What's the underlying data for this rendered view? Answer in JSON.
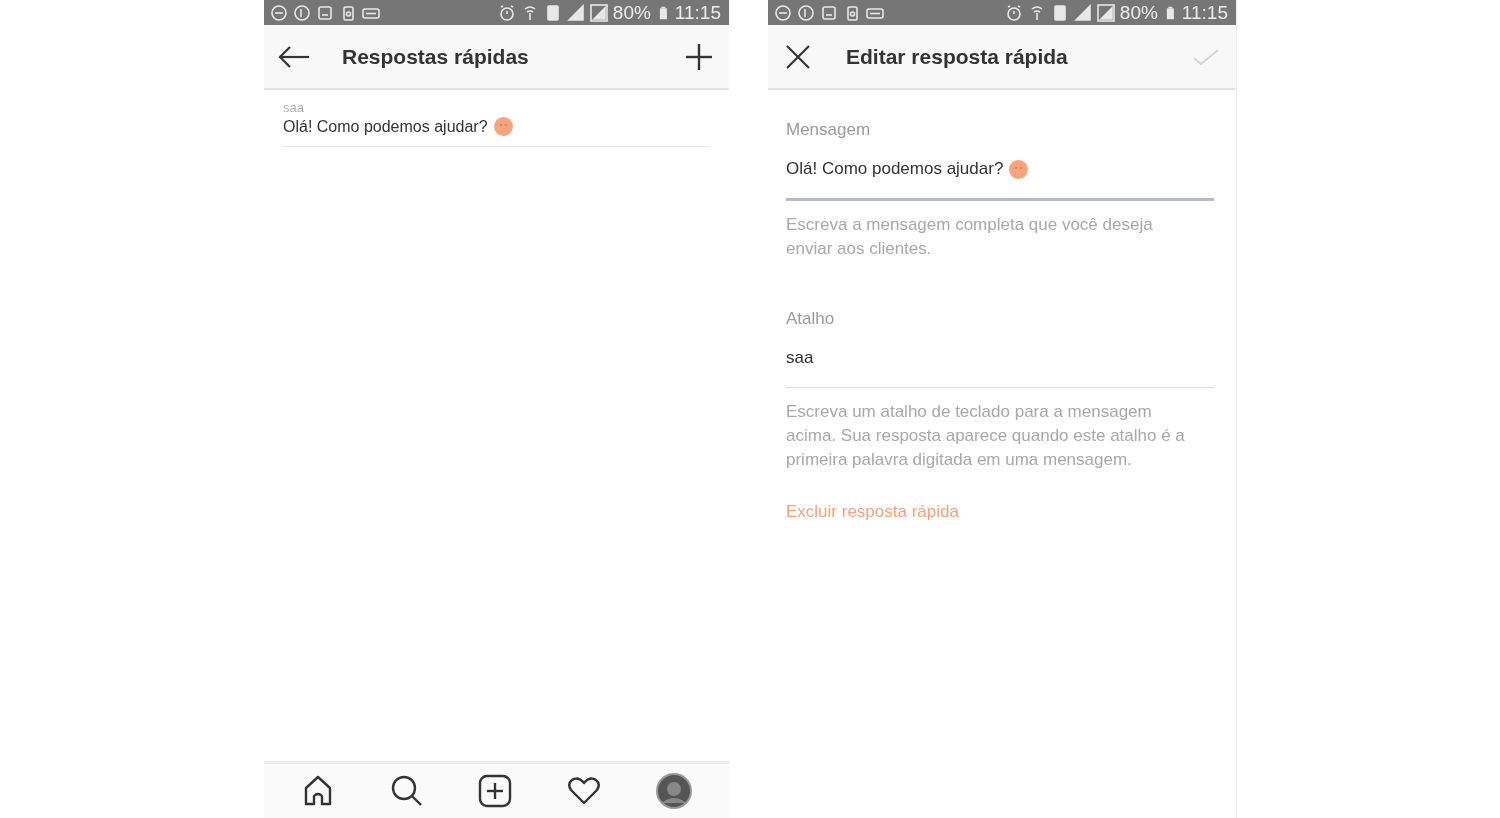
{
  "screens": [
    {
      "kind": "list",
      "status_bar": {
        "battery": "80%",
        "time": "11:15"
      },
      "header": {
        "title": "Respostas rápidas"
      },
      "items": [
        {
          "shortcut": "saa",
          "message": "Olá! Como podemos ajudar?"
        }
      ],
      "bottom_nav": [
        {
          "kind": "home"
        },
        {
          "kind": "search"
        },
        {
          "kind": "add"
        },
        {
          "kind": "heart"
        },
        {
          "kind": "avatar"
        }
      ]
    },
    {
      "kind": "edit",
      "status_bar": {
        "battery": "80%",
        "time": "11:15"
      },
      "header": {
        "title": "Editar resposta rápida",
        "save_disabled": true
      },
      "fields": [
        {
          "label": "Mensagem",
          "value": "Olá! Como podemos ajudar?",
          "emoji": true,
          "focused": true,
          "help": "Escreva a mensagem completa que você deseja enviar aos clientes."
        },
        {
          "label": "Atalho",
          "value": "saa",
          "emoji": false,
          "focused": false,
          "help": "Escreva um atalho de teclado para a mensagem acima. Sua resposta aparece quando este atalho é a primeira palavra digitada em uma mensagem."
        }
      ],
      "delete_link": "Excluir resposta rápida"
    }
  ]
}
